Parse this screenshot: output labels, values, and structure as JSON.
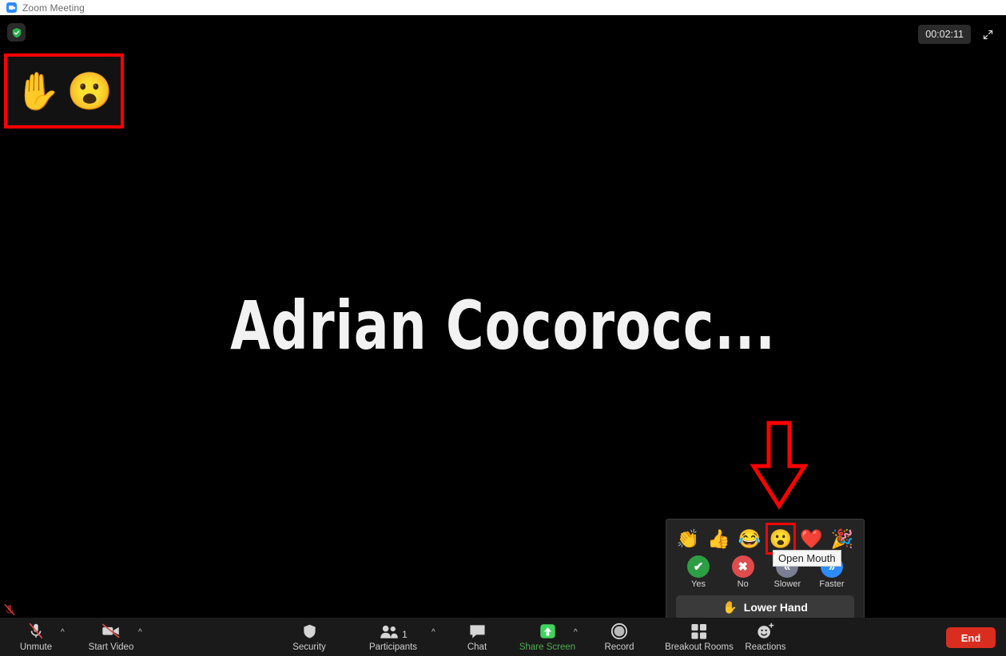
{
  "titlebar": {
    "title": "Zoom Meeting",
    "logo_icon": "zoom-camera-icon"
  },
  "stage": {
    "participant_name": "Adrian  Cocorocc...",
    "security_badge_icon": "green-shield-check-icon",
    "timer": "00:02:11",
    "fullscreen_icon": "expand-arrows-icon",
    "reaction_badges": [
      {
        "icon": "raised-hand-emoji",
        "glyph": "✋"
      },
      {
        "icon": "open-mouth-face-emoji",
        "glyph": "😮"
      }
    ]
  },
  "annotations": {
    "arrow_color": "#ff0000",
    "highlight_color": "#ff0000"
  },
  "reactions_popup": {
    "emojis": [
      {
        "name": "clapping-hands",
        "glyph": "👏",
        "selected": false
      },
      {
        "name": "thumbs-up",
        "glyph": "👍",
        "selected": false
      },
      {
        "name": "joy-face",
        "glyph": "😂",
        "selected": false
      },
      {
        "name": "open-mouth",
        "glyph": "😮",
        "selected": true
      },
      {
        "name": "red-heart",
        "glyph": "❤️",
        "selected": false
      },
      {
        "name": "party-popper",
        "glyph": "🎉",
        "selected": false
      }
    ],
    "tooltip": "Open Mouth",
    "statuses": [
      {
        "label": "Yes",
        "glyph": "✔",
        "color": "#2e9e44"
      },
      {
        "label": "No",
        "glyph": "✖",
        "color": "#e04b4b"
      },
      {
        "label": "Slower",
        "glyph": "«",
        "color": "#7a7f93"
      },
      {
        "label": "Faster",
        "glyph": "»",
        "color": "#2d8cff"
      }
    ],
    "lower_hand_label": "Lower Hand",
    "lower_hand_emoji": "✋"
  },
  "toolbar": {
    "mic_indicator_icon": "muted-mic-indicator-icon",
    "items": [
      {
        "label": "Unmute",
        "icon": "mic-muted-icon",
        "chevron": true,
        "green": false
      },
      {
        "label": "Start Video",
        "icon": "video-muted-icon",
        "chevron": true,
        "green": false
      },
      {
        "label": "Security",
        "icon": "shield-icon",
        "chevron": false,
        "green": false
      },
      {
        "label": "Participants",
        "icon": "participants-icon",
        "chevron": true,
        "green": false,
        "count": "1"
      },
      {
        "label": "Chat",
        "icon": "chat-bubble-icon",
        "chevron": false,
        "green": false
      },
      {
        "label": "Share Screen",
        "icon": "share-screen-icon",
        "chevron": true,
        "green": true
      },
      {
        "label": "Record",
        "icon": "record-icon",
        "chevron": false,
        "green": false
      },
      {
        "label": "Breakout Rooms",
        "icon": "breakout-rooms-icon",
        "chevron": false,
        "green": false
      },
      {
        "label": "Reactions",
        "icon": "reactions-icon",
        "chevron": false,
        "green": false
      }
    ],
    "end_label": "End",
    "end_color": "#d92d20"
  }
}
